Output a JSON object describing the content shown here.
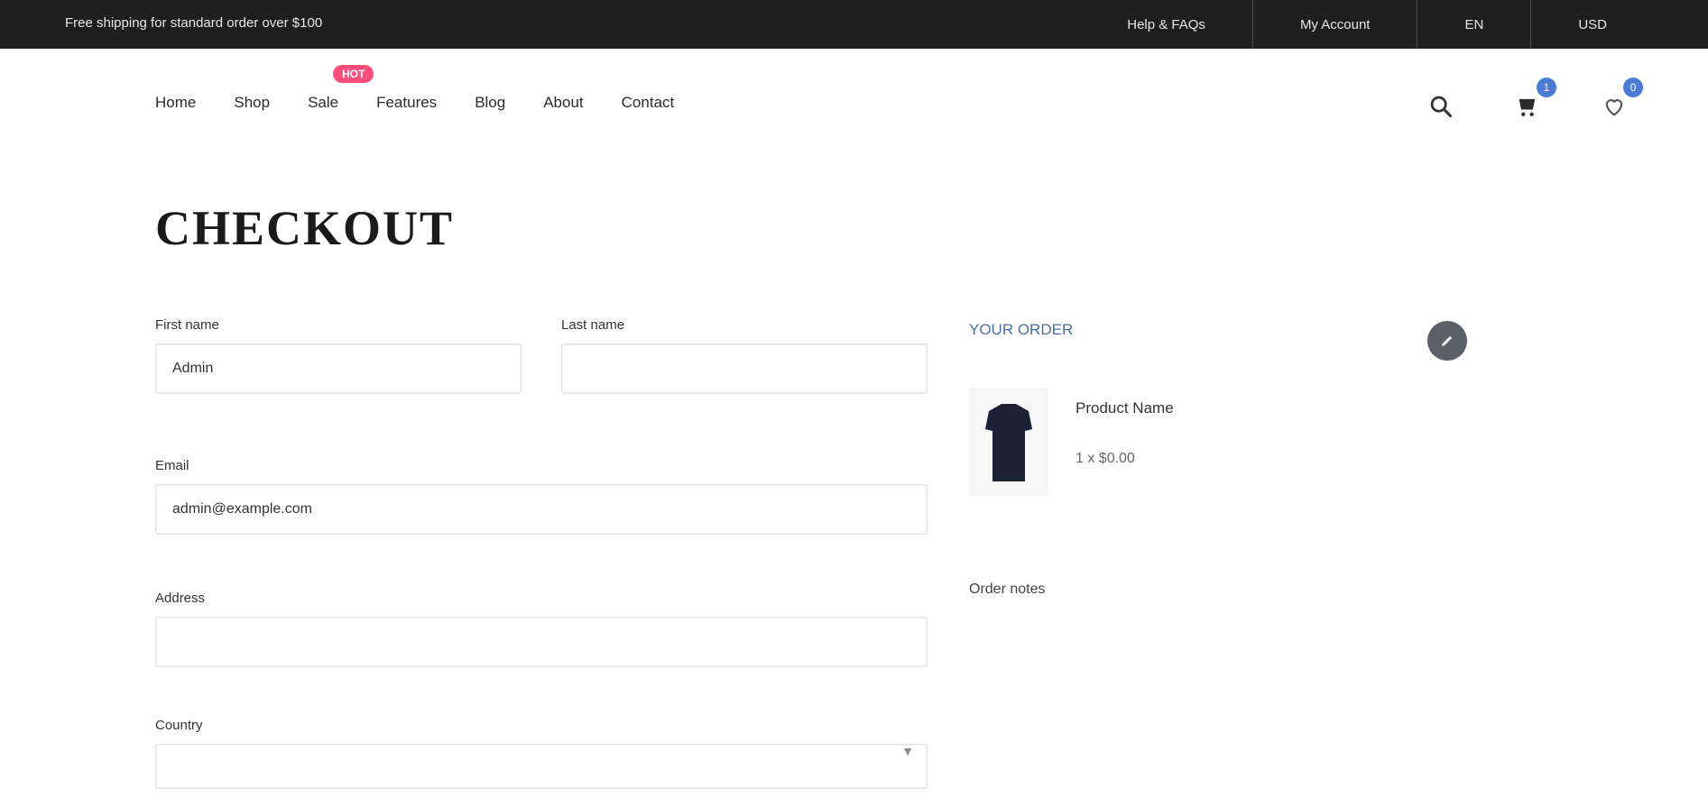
{
  "topbar": {
    "promo": "Free shipping for standard order over $100",
    "links": [
      "Help & FAQs",
      "My Account",
      "EN",
      "USD"
    ]
  },
  "nav": {
    "items": [
      "Home",
      "Shop",
      "Sale",
      "Features",
      "Blog",
      "About",
      "Contact"
    ],
    "badge": "HOT"
  },
  "header_icons": {
    "search": "search-icon",
    "cart": "cart-icon",
    "cart_count": "1",
    "wishlist": "heart-icon",
    "wishlist_count": "0"
  },
  "page": {
    "title": "CHECKOUT"
  },
  "form": {
    "first_name": {
      "label": "First name",
      "value": "Admin"
    },
    "last_name": {
      "label": "Last name",
      "value": ""
    },
    "email": {
      "label": "Email",
      "value": "admin@example.com"
    },
    "address": {
      "label": "Address",
      "value": ""
    },
    "country": {
      "label": "Country",
      "value": ""
    }
  },
  "summary": {
    "title": "YOUR ORDER",
    "edit_icon": "pencil-icon",
    "product_name": "Product Name",
    "product_price": "1 x $0.00",
    "order_notes": "Order notes"
  }
}
